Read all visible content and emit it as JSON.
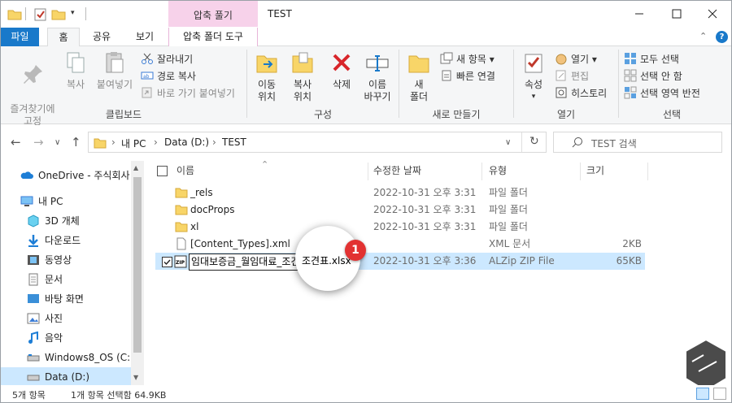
{
  "window": {
    "title": "TEST",
    "contextual_tab_header": "압축 풀기"
  },
  "ribbon_tabs": {
    "file": "파일",
    "home": "홈",
    "share": "공유",
    "view": "보기",
    "tools": "압축 폴더 도구"
  },
  "ribbon": {
    "clipboard": {
      "label": "클립보드",
      "pin": "즐겨찾기에\n고정",
      "copy": "복사",
      "paste": "붙여넣기",
      "cut": "잘라내기",
      "copy_path": "경로 복사",
      "paste_shortcut": "바로 가기 붙여넣기"
    },
    "organize": {
      "label": "구성",
      "move_to": "이동\n위치",
      "copy_to": "복사\n위치",
      "delete": "삭제",
      "rename": "이름\n바꾸기"
    },
    "new": {
      "label": "새로 만들기",
      "new_folder": "새\n폴더",
      "new_item": "새 항목",
      "easy_access": "빠른 연결"
    },
    "open": {
      "label": "열기",
      "properties": "속성",
      "open": "열기",
      "edit": "편집",
      "history": "히스토리"
    },
    "select": {
      "label": "선택",
      "select_all": "모두 선택",
      "select_none": "선택 안 함",
      "invert": "선택 영역 반전"
    }
  },
  "address": {
    "crumbs": [
      "내 PC",
      "Data (D:)",
      "TEST"
    ],
    "search_placeholder": "TEST 검색"
  },
  "nav_pane": {
    "items": [
      {
        "label": "OneDrive - 주식회사",
        "icon": "onedrive-icon"
      },
      {
        "label": "내 PC",
        "icon": "pc-icon"
      },
      {
        "label": "3D 개체",
        "icon": "3d-objects-icon"
      },
      {
        "label": "다운로드",
        "icon": "download-icon"
      },
      {
        "label": "동영상",
        "icon": "video-icon"
      },
      {
        "label": "문서",
        "icon": "document-icon"
      },
      {
        "label": "바탕 화면",
        "icon": "desktop-icon"
      },
      {
        "label": "사진",
        "icon": "picture-icon"
      },
      {
        "label": "음악",
        "icon": "music-icon"
      },
      {
        "label": "Windows8_OS (C:)",
        "icon": "drive-icon"
      },
      {
        "label": "Data (D:)",
        "icon": "drive-icon"
      }
    ]
  },
  "file_list": {
    "headers": {
      "name": "이름",
      "modified": "수정한 날짜",
      "type": "유형",
      "size": "크기"
    },
    "rows": [
      {
        "name": "_rels",
        "modified": "2022-10-31 오후 3:31",
        "type": "파일 폴더",
        "size": "",
        "icon": "folder-icon"
      },
      {
        "name": "docProps",
        "modified": "2022-10-31 오후 3:31",
        "type": "파일 폴더",
        "size": "",
        "icon": "folder-icon"
      },
      {
        "name": "xl",
        "modified": "2022-10-31 오후 3:31",
        "type": "파일 폴더",
        "size": "",
        "icon": "folder-icon"
      },
      {
        "name": "[Content_Types].xml",
        "modified": "",
        "type": "XML 문서",
        "size": "2KB",
        "icon": "xml-file-icon"
      },
      {
        "name": "임대보증금_월임대료_조견표.xlsx",
        "modified": "2022-10-31 오후 3:36",
        "type": "ALZip ZIP File",
        "size": "65KB",
        "icon": "zip-file-icon"
      }
    ],
    "rename_value": "임대보증금_월임대료_조견표.xlsx",
    "magnifier_text": "조견표.xlsx",
    "callout_number": "1"
  },
  "status": {
    "count": "5개 항목",
    "selected": "1개 항목 선택함 64.9KB"
  },
  "colors": {
    "accent": "#1979ca",
    "selection": "#cce8ff",
    "context_tab": "#f7d2ea",
    "callout": "#e23232"
  }
}
